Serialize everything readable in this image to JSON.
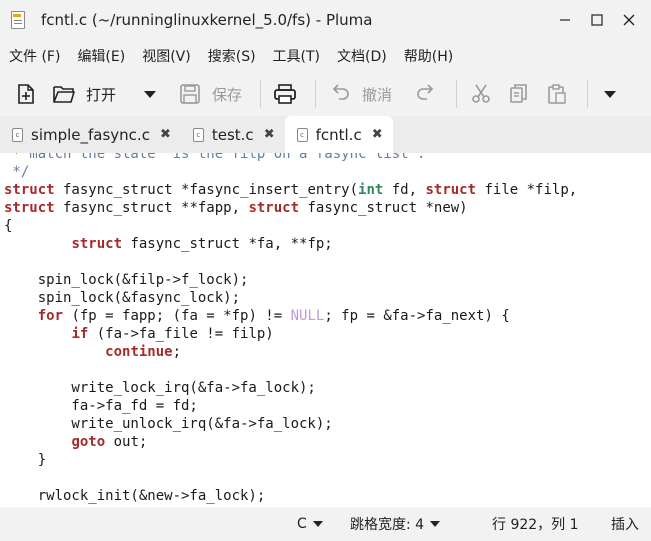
{
  "window": {
    "title": "fcntl.c (~/runninglinuxkernel_5.0/fs) - Pluma",
    "minimize": "—",
    "maximize": "☐",
    "close": "✕"
  },
  "menu": {
    "items": [
      "文件 (F)",
      "编辑(E)",
      "视图(V)",
      "搜索(S)",
      "工具(T)",
      "文档(D)",
      "帮助(H)"
    ]
  },
  "toolbar": {
    "open_label": "打开",
    "save_label": "保存",
    "undo_label": "撤消"
  },
  "tabs": [
    {
      "label": "simple_fasync.c",
      "close": "✖"
    },
    {
      "label": "test.c",
      "close": "✖"
    },
    {
      "label": "fcntl.c",
      "close": "✖"
    }
  ],
  "editor": {
    "lines": [
      [
        {
          "t": " * match the state \"is the filp on a fasync list\".",
          "c": "cm"
        }
      ],
      [
        {
          "t": " */",
          "c": "cm"
        }
      ],
      [
        {
          "t": "struct",
          "c": "kw"
        },
        {
          "t": " fasync_struct *fasync_insert_entry("
        },
        {
          "t": "int",
          "c": "ty"
        },
        {
          "t": " fd, "
        },
        {
          "t": "struct",
          "c": "kw"
        },
        {
          "t": " file *filp,"
        }
      ],
      [
        {
          "t": "struct",
          "c": "kw"
        },
        {
          "t": " fasync_struct **fapp, "
        },
        {
          "t": "struct",
          "c": "kw"
        },
        {
          "t": " fasync_struct *new)"
        }
      ],
      [
        {
          "t": "{"
        }
      ],
      [
        {
          "t": "        "
        },
        {
          "t": "struct",
          "c": "kw"
        },
        {
          "t": " fasync_struct *fa, **fp;"
        }
      ],
      [
        {
          "t": ""
        }
      ],
      [
        {
          "t": "    spin_lock(&filp->f_lock);"
        }
      ],
      [
        {
          "t": "    spin_lock(&fasync_lock);"
        }
      ],
      [
        {
          "t": "    "
        },
        {
          "t": "for",
          "c": "kw"
        },
        {
          "t": " (fp = fapp; (fa = *fp) != "
        },
        {
          "t": "NULL",
          "c": "nul"
        },
        {
          "t": "; fp = &fa->fa_next) {"
        }
      ],
      [
        {
          "t": "        "
        },
        {
          "t": "if",
          "c": "kw"
        },
        {
          "t": " (fa->fa_file != filp)"
        }
      ],
      [
        {
          "t": "            "
        },
        {
          "t": "continue",
          "c": "kw"
        },
        {
          "t": ";"
        }
      ],
      [
        {
          "t": ""
        }
      ],
      [
        {
          "t": "        write_lock_irq(&fa->fa_lock);"
        }
      ],
      [
        {
          "t": "        fa->fa_fd = fd;"
        }
      ],
      [
        {
          "t": "        write_unlock_irq(&fa->fa_lock);"
        }
      ],
      [
        {
          "t": "        "
        },
        {
          "t": "goto",
          "c": "kw"
        },
        {
          "t": " out;"
        }
      ],
      [
        {
          "t": "    }"
        }
      ],
      [
        {
          "t": ""
        }
      ],
      [
        {
          "t": "    rwlock_init(&new->fa_lock);"
        }
      ]
    ]
  },
  "status": {
    "language": "C",
    "tab_width": "跳格宽度: 4",
    "position": "行 922，列 1",
    "mode": "插入"
  },
  "colors": {
    "keyword": "#a52a2a",
    "type": "#2e8b57",
    "comment": "#5f7ea8",
    "null": "#c09ae0"
  }
}
